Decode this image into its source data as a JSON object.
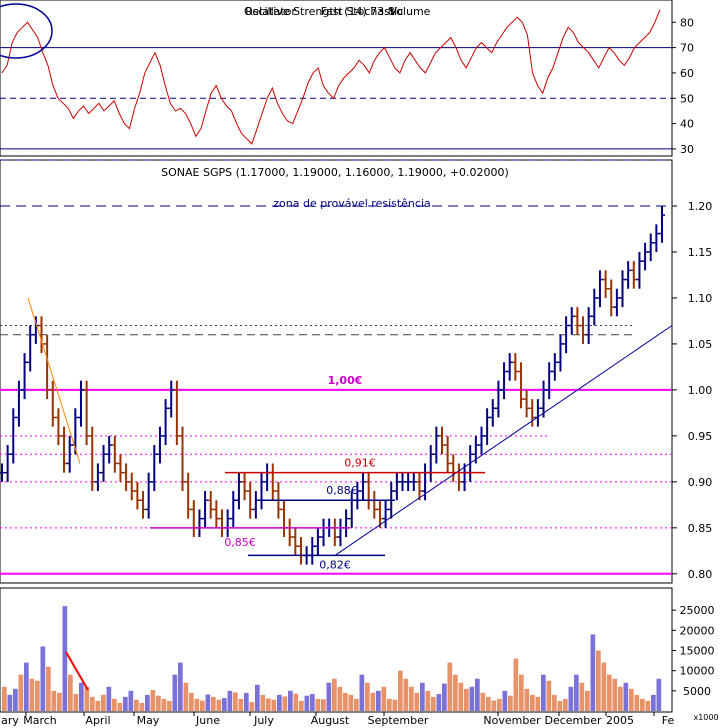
{
  "chart_data": [
    {
      "type": "line",
      "panel": "indicator",
      "title": "Relative Strength (14) 73.8",
      "overlay_titles": [
        "Oscillator",
        "Fast Stochastic",
        "Volume"
      ],
      "ylim": [
        28,
        88
      ],
      "yticks": [
        30,
        40,
        50,
        60,
        70,
        80
      ],
      "reference_lines": [
        70,
        50,
        30
      ],
      "series": [
        {
          "values": [
            60,
            63,
            72,
            76,
            78,
            80,
            77,
            74,
            68,
            63,
            55,
            50,
            48,
            46,
            42,
            45,
            47,
            44,
            46,
            48,
            45,
            47,
            49,
            44,
            40,
            38,
            46,
            52,
            60,
            64,
            68,
            63,
            55,
            48,
            45,
            46,
            44,
            40,
            35,
            38,
            45,
            52,
            55,
            50,
            47,
            45,
            40,
            36,
            34,
            32,
            38,
            44,
            50,
            54,
            48,
            44,
            41,
            40,
            45,
            50,
            56,
            60,
            62,
            55,
            52,
            50,
            55,
            58,
            60,
            62,
            65,
            63,
            60,
            65,
            68,
            70,
            66,
            62,
            60,
            65,
            68,
            65,
            62,
            60,
            64,
            68,
            70,
            72,
            74,
            70,
            65,
            62,
            66,
            70,
            72,
            70,
            68,
            72,
            75,
            78,
            80,
            82,
            80,
            75,
            60,
            55,
            52,
            58,
            62,
            68,
            74,
            78,
            76,
            72,
            70,
            68,
            65,
            62,
            66,
            70,
            68,
            65,
            63,
            66,
            70,
            72,
            74,
            76,
            80,
            85
          ]
        }
      ],
      "annotations": []
    },
    {
      "type": "ohlc",
      "panel": "price",
      "title": "SONAE SGPS (1.17000, 1.19000, 1.16000, 1.19000, +0.02000)",
      "ylim": [
        0.79,
        1.25
      ],
      "yticks": [
        0.8,
        0.85,
        0.9,
        0.95,
        1.0,
        1.05,
        1.1,
        1.15,
        1.2
      ],
      "x_tick_labels": [
        "ary",
        "March",
        "April",
        "May",
        "June",
        "July",
        "August",
        "September",
        "November",
        "December",
        "2005",
        "Fe"
      ],
      "close": [
        0.91,
        0.93,
        0.97,
        1.0,
        1.03,
        1.06,
        1.07,
        1.05,
        1.0,
        0.97,
        0.95,
        0.92,
        0.94,
        0.97,
        1.0,
        0.95,
        0.9,
        0.91,
        0.93,
        0.94,
        0.92,
        0.91,
        0.9,
        0.89,
        0.88,
        0.87,
        0.9,
        0.93,
        0.95,
        0.98,
        1.0,
        0.95,
        0.9,
        0.87,
        0.85,
        0.86,
        0.88,
        0.87,
        0.86,
        0.85,
        0.86,
        0.88,
        0.9,
        0.89,
        0.87,
        0.88,
        0.9,
        0.91,
        0.89,
        0.87,
        0.85,
        0.84,
        0.83,
        0.82,
        0.82,
        0.83,
        0.84,
        0.85,
        0.85,
        0.84,
        0.85,
        0.86,
        0.88,
        0.89,
        0.9,
        0.88,
        0.87,
        0.86,
        0.87,
        0.89,
        0.9,
        0.9,
        0.9,
        0.9,
        0.89,
        0.91,
        0.93,
        0.95,
        0.94,
        0.92,
        0.91,
        0.9,
        0.91,
        0.93,
        0.94,
        0.95,
        0.97,
        0.98,
        1.0,
        1.02,
        1.03,
        1.02,
        0.99,
        0.98,
        0.97,
        0.98,
        1.0,
        1.02,
        1.03,
        1.05,
        1.07,
        1.08,
        1.07,
        1.06,
        1.08,
        1.1,
        1.12,
        1.11,
        1.09,
        1.1,
        1.12,
        1.13,
        1.12,
        1.14,
        1.15,
        1.16,
        1.17,
        1.19
      ],
      "horizontal_levels": [
        {
          "value": 1.0,
          "label": "1,00€"
        },
        {
          "value": 0.91,
          "label": "0,91€"
        },
        {
          "value": 0.88,
          "label": "0,88€"
        },
        {
          "value": 0.85,
          "label": "0,85€"
        },
        {
          "value": 0.82,
          "label": "0,82€"
        }
      ],
      "zone_label": "zona de provável resistência",
      "resistance_band": [
        1.2,
        1.25
      ]
    },
    {
      "type": "bar",
      "panel": "volume",
      "axis_unit_label": "x1000",
      "ylim": [
        0,
        30000
      ],
      "yticks": [
        5000,
        10000,
        15000,
        20000,
        25000
      ],
      "values": [
        6000,
        4000,
        5500,
        9000,
        12000,
        8000,
        7500,
        16000,
        11000,
        5000,
        4500,
        26000,
        9000,
        4200,
        7000,
        6000,
        3500,
        2500,
        4000,
        6000,
        3000,
        2000,
        3500,
        5000,
        2800,
        2000,
        4000,
        5200,
        3800,
        3000,
        2500,
        9000,
        12000,
        7000,
        4500,
        3000,
        2600,
        4100,
        3500,
        2800,
        3200,
        5000,
        4600,
        3000,
        4500,
        2200,
        6500,
        4000,
        3100,
        2800,
        4000,
        3600,
        5000,
        4300,
        2500,
        3800,
        4200,
        3000,
        2900,
        7000,
        8000,
        6000,
        4500,
        4000,
        3000,
        9000,
        7000,
        4500,
        5000,
        6000,
        3000,
        2800,
        10000,
        8000,
        6000,
        4500,
        7000,
        5000,
        3500,
        4200,
        6800,
        12000,
        9000,
        7000,
        5500,
        6000,
        8000,
        4500,
        3500,
        2600,
        3000,
        5000,
        3800,
        13000,
        9000,
        5500,
        4000,
        3500,
        9000,
        7500,
        4000,
        2500,
        3000,
        6000,
        9000,
        7000,
        5000,
        19000,
        15000,
        12000,
        9000,
        8000,
        6000,
        7000,
        5500,
        4000,
        3000,
        2500,
        4000,
        8000
      ]
    }
  ]
}
